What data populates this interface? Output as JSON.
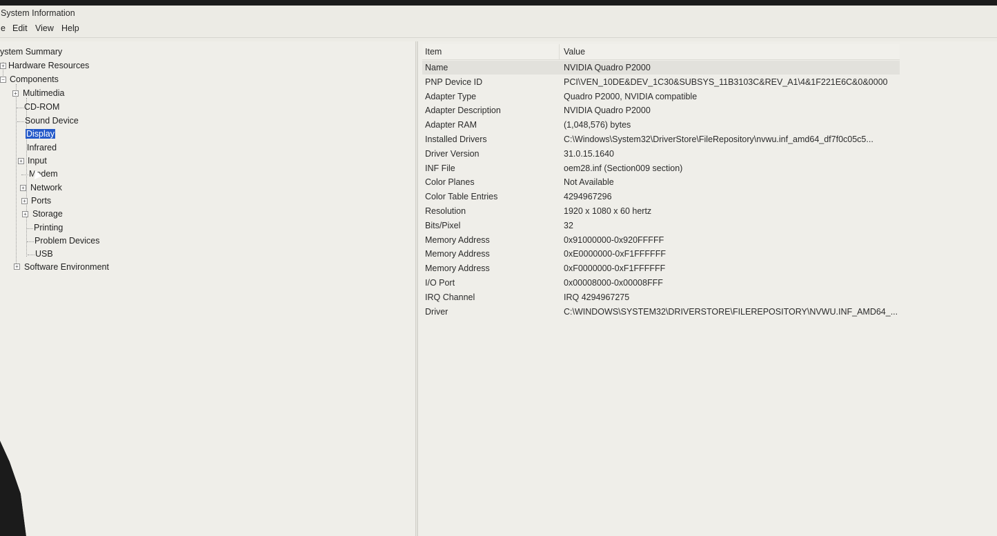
{
  "window": {
    "title": "System Information"
  },
  "menu": [
    "e",
    "Edit",
    "View",
    "Help"
  ],
  "tree": {
    "system_summary": "ystem Summary",
    "hardware_resources": "Hardware Resources",
    "components": "Components",
    "multimedia": "Multimedia",
    "cd_rom": "CD-ROM",
    "sound_device": "Sound Device",
    "display": "Display",
    "infrared": "Infrared",
    "input": "Input",
    "modem": "Modem",
    "network": "Network",
    "ports": "Ports",
    "storage": "Storage",
    "printing": "Printing",
    "problem_devices": "Problem Devices",
    "usb": "USB",
    "software_environment": "Software Environment"
  },
  "list": {
    "header_item": "Item",
    "header_value": "Value",
    "rows": [
      {
        "item": "Name",
        "value": "NVIDIA Quadro P2000"
      },
      {
        "item": "PNP Device ID",
        "value": "PCI\\VEN_10DE&DEV_1C30&SUBSYS_11B3103C&REV_A1\\4&1F221E6C&0&0000"
      },
      {
        "item": "Adapter Type",
        "value": "Quadro P2000, NVIDIA compatible"
      },
      {
        "item": "Adapter Description",
        "value": "NVIDIA Quadro P2000"
      },
      {
        "item": "Adapter RAM",
        "value": "(1,048,576) bytes"
      },
      {
        "item": "Installed Drivers",
        "value": "C:\\Windows\\System32\\DriverStore\\FileRepository\\nvwu.inf_amd64_df7f0c05c5..."
      },
      {
        "item": "Driver Version",
        "value": "31.0.15.1640"
      },
      {
        "item": "INF File",
        "value": "oem28.inf (Section009 section)"
      },
      {
        "item": "Color Planes",
        "value": "Not Available"
      },
      {
        "item": "Color Table Entries",
        "value": "4294967296"
      },
      {
        "item": "Resolution",
        "value": "1920 x 1080 x 60 hertz"
      },
      {
        "item": "Bits/Pixel",
        "value": "32"
      },
      {
        "item": "Memory Address",
        "value": "0x91000000-0x920FFFFF"
      },
      {
        "item": "Memory Address",
        "value": "0xE0000000-0xF1FFFFFF"
      },
      {
        "item": "Memory Address",
        "value": "0xF0000000-0xF1FFFFFF"
      },
      {
        "item": "I/O Port",
        "value": "0x00008000-0x00008FFF"
      },
      {
        "item": "IRQ Channel",
        "value": "IRQ 4294967275"
      },
      {
        "item": "Driver",
        "value": "C:\\WINDOWS\\SYSTEM32\\DRIVERSTORE\\FILEREPOSITORY\\NVWU.INF_AMD64_..."
      }
    ]
  }
}
